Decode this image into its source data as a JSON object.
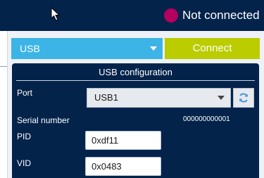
{
  "header": {
    "connection_status": "Not connected",
    "status_color": "#b5005f",
    "cursor_icon": "arrow-cursor-icon"
  },
  "toolbar": {
    "interface_value": "USB",
    "connect_label": "Connect",
    "accent_blue": "#3cb4e6",
    "accent_green": "#bbcc00"
  },
  "usb_config": {
    "title": "USB configuration",
    "port": {
      "label": "Port",
      "value": "USB1",
      "refresh_icon": "refresh-icon"
    },
    "serial": {
      "label": "Serial number",
      "value": "000000000001"
    },
    "pid": {
      "label": "PID",
      "value": "0xdf11"
    },
    "vid": {
      "label": "VID",
      "value": "0x0483"
    }
  }
}
